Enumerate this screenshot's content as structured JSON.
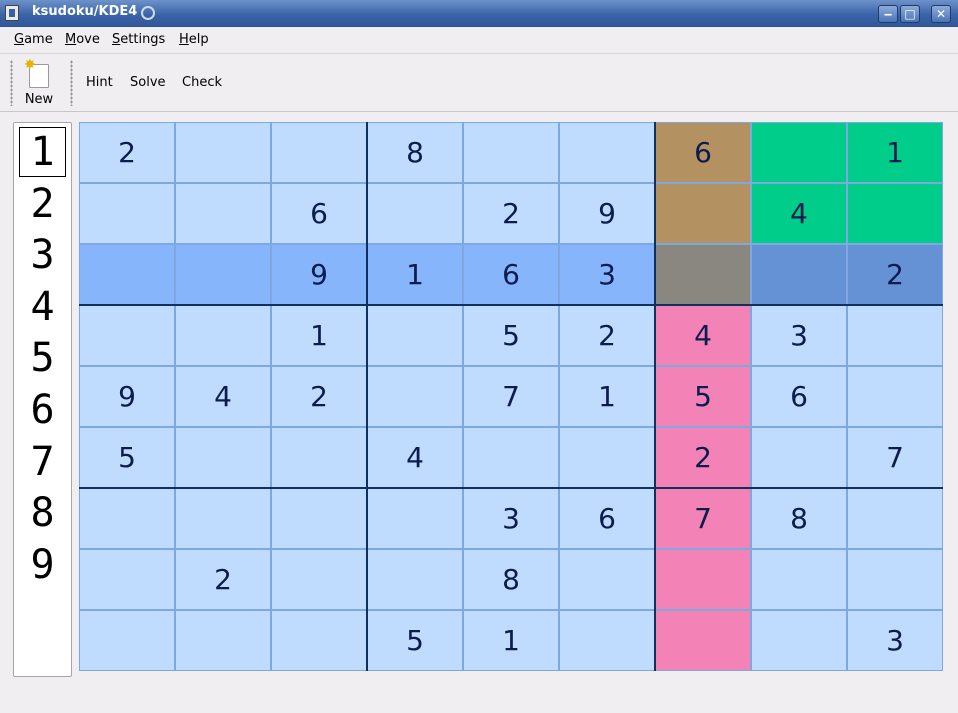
{
  "window": {
    "title": "ksudoku/KDE4",
    "buttons": {
      "minimize": "‒",
      "maximize": "□",
      "close": "✕"
    }
  },
  "menu": [
    {
      "label": "Game",
      "underline": "G",
      "rest": "ame"
    },
    {
      "label": "Move",
      "underline": "M",
      "rest": "ove"
    },
    {
      "label": "Settings",
      "underline": "S",
      "rest": "ettings"
    },
    {
      "label": "Help",
      "underline": "H",
      "rest": "elp"
    }
  ],
  "toolbar": {
    "new_label": "New",
    "hint_label": "Hint",
    "solve_label": "Solve",
    "check_label": "Check"
  },
  "palette": {
    "numbers": [
      "1",
      "2",
      "3",
      "4",
      "5",
      "6",
      "7",
      "8",
      "9"
    ],
    "selected": "1"
  },
  "colors": {
    "cell": "#bfdbfd",
    "row_highlight": "#86b5fc",
    "col_highlight": "#f383b6",
    "brown": "#b49161",
    "green": "#00cd8a",
    "grey": "#8a8780",
    "blue_mid": "#6592d5",
    "digit": "#0c1c4f"
  },
  "board": {
    "grid": [
      [
        "2",
        "",
        "",
        "8",
        "",
        "",
        "6",
        "",
        "1"
      ],
      [
        "",
        "",
        "6",
        "",
        "2",
        "9",
        "",
        "4",
        ""
      ],
      [
        "",
        "",
        "9",
        "1",
        "6",
        "3",
        "",
        "",
        "2"
      ],
      [
        "",
        "",
        "1",
        "",
        "5",
        "2",
        "4",
        "3",
        ""
      ],
      [
        "9",
        "4",
        "2",
        "",
        "7",
        "1",
        "5",
        "6",
        ""
      ],
      [
        "5",
        "",
        "",
        "4",
        "",
        "",
        "2",
        "",
        "7"
      ],
      [
        "",
        "",
        "",
        "",
        "3",
        "6",
        "7",
        "8",
        ""
      ],
      [
        "",
        "2",
        "",
        "",
        "8",
        "",
        "",
        "",
        ""
      ],
      [
        "",
        "",
        "",
        "5",
        "1",
        "",
        "",
        "",
        "3"
      ]
    ],
    "cell_colors": [
      [
        "cell",
        "cell",
        "cell",
        "cell",
        "cell",
        "cell",
        "brown",
        "green",
        "green"
      ],
      [
        "cell",
        "cell",
        "cell",
        "cell",
        "cell",
        "cell",
        "brown",
        "green",
        "green"
      ],
      [
        "row_highlight",
        "row_highlight",
        "row_highlight",
        "row_highlight",
        "row_highlight",
        "row_highlight",
        "grey",
        "blue_mid",
        "blue_mid"
      ],
      [
        "cell",
        "cell",
        "cell",
        "cell",
        "cell",
        "cell",
        "col_highlight",
        "cell",
        "cell"
      ],
      [
        "cell",
        "cell",
        "cell",
        "cell",
        "cell",
        "cell",
        "col_highlight",
        "cell",
        "cell"
      ],
      [
        "cell",
        "cell",
        "cell",
        "cell",
        "cell",
        "cell",
        "col_highlight",
        "cell",
        "cell"
      ],
      [
        "cell",
        "cell",
        "cell",
        "cell",
        "cell",
        "cell",
        "col_highlight",
        "cell",
        "cell"
      ],
      [
        "cell",
        "cell",
        "cell",
        "cell",
        "cell",
        "cell",
        "col_highlight",
        "cell",
        "cell"
      ],
      [
        "cell",
        "cell",
        "cell",
        "cell",
        "cell",
        "cell",
        "col_highlight",
        "cell",
        "cell"
      ]
    ]
  }
}
